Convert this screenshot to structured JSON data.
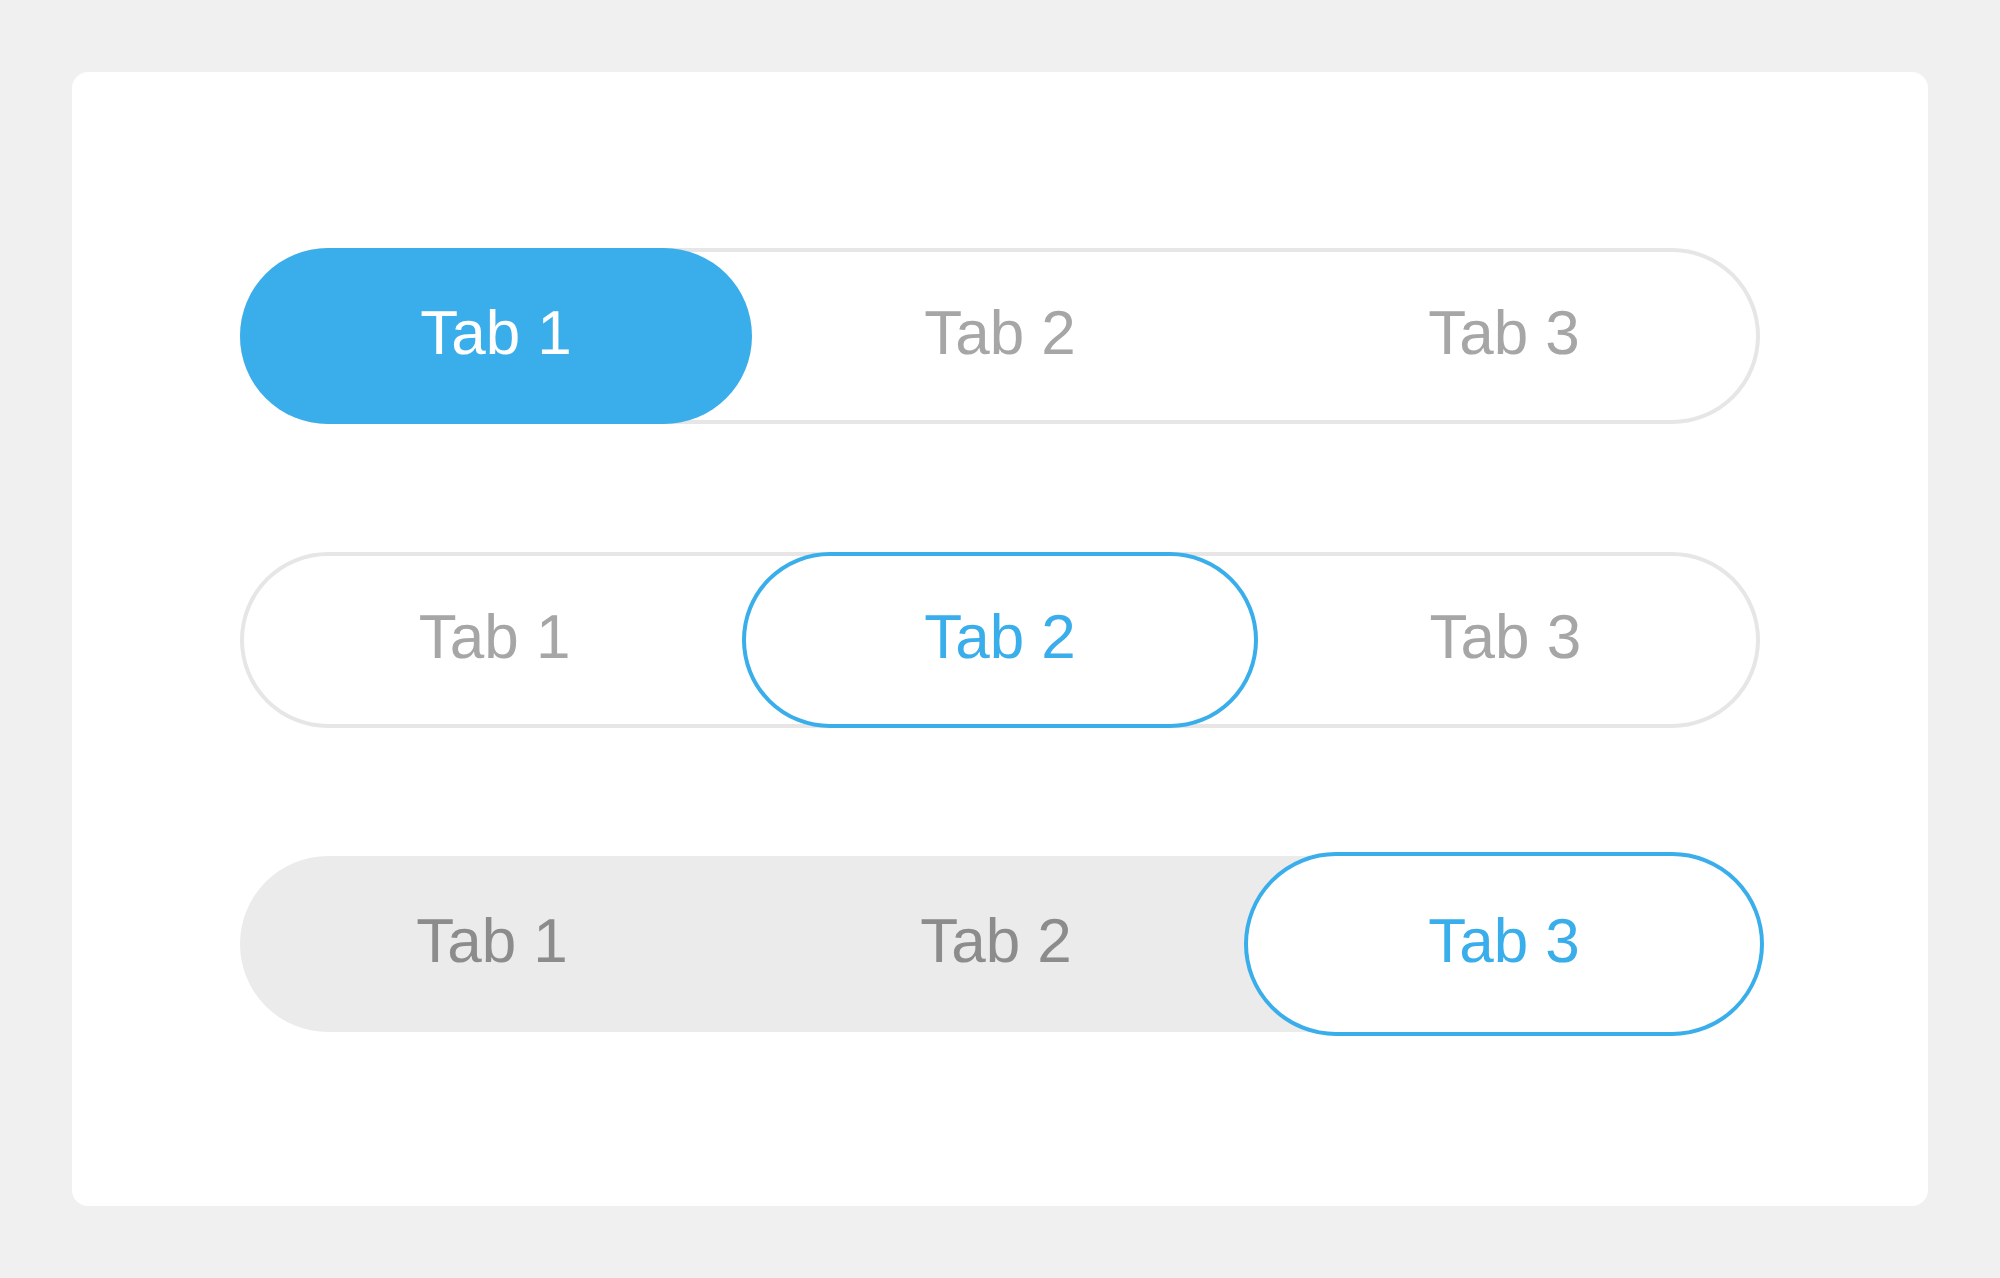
{
  "tab_groups": [
    {
      "kind": "filled",
      "tabs": [
        {
          "label": "Tab 1",
          "selected": true
        },
        {
          "label": "Tab 2",
          "selected": false
        },
        {
          "label": "Tab 3",
          "selected": false
        }
      ]
    },
    {
      "kind": "outlined",
      "tabs": [
        {
          "label": "Tab 1",
          "selected": false
        },
        {
          "label": "Tab 2",
          "selected": true
        },
        {
          "label": "Tab 3",
          "selected": false
        }
      ]
    },
    {
      "kind": "muted",
      "tabs": [
        {
          "label": "Tab 1",
          "selected": false
        },
        {
          "label": "Tab 2",
          "selected": false
        },
        {
          "label": "Tab 3",
          "selected": true
        }
      ]
    }
  ]
}
